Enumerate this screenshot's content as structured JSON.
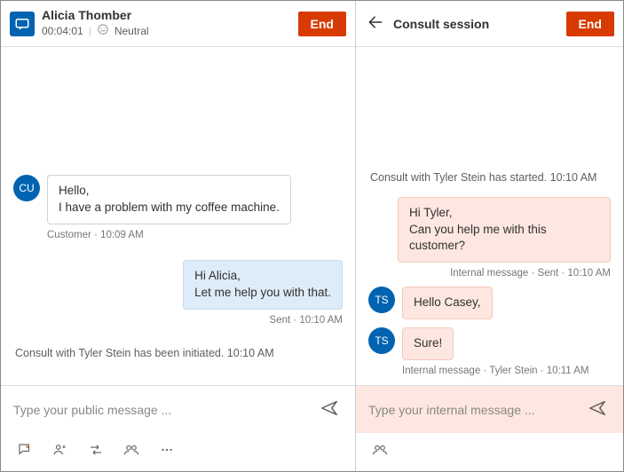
{
  "left": {
    "customer_name": "Alicia Thomber",
    "timer": "00:04:01",
    "sentiment": "Neutral",
    "end_label": "End",
    "avatar_initials": "CU",
    "customer_message": "Hello,\nI have a problem with my coffee machine.",
    "customer_meta": "Customer · 10:09 AM",
    "agent_message": "Hi Alicia,\nLet me help you with that.",
    "agent_meta": "Sent · 10:10 AM",
    "system_line": "Consult with Tyler Stein has been initiated. 10:10 AM",
    "composer_placeholder": "Type your public message ..."
  },
  "right": {
    "title": "Consult session",
    "end_label": "End",
    "system_start": "Consult with Tyler Stein has started. 10:10 AM",
    "out_message": "Hi Tyler,\nCan you help me with this customer?",
    "out_meta": "Internal message · Sent · 10:10 AM",
    "ts_initials": "TS",
    "in1": "Hello Casey,",
    "in2": "Sure!",
    "in_meta": "Internal message · Tyler Stein · 10:11 AM",
    "composer_placeholder": "Type your internal message ..."
  }
}
